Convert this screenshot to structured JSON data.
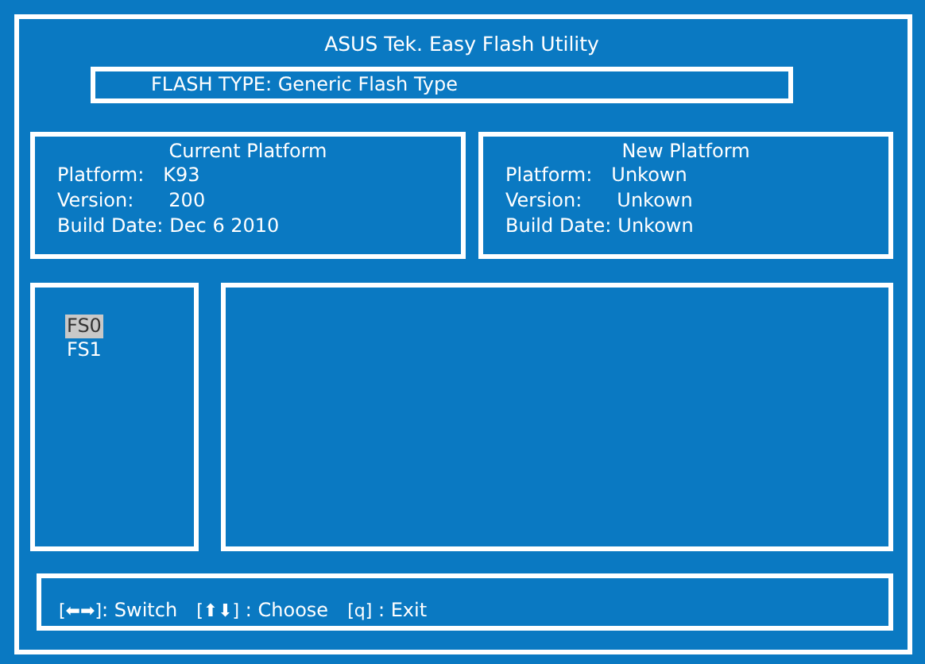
{
  "title": "ASUS Tek. Easy Flash Utility",
  "flash_type": "FLASH TYPE: Generic Flash Type",
  "platforms": [
    {
      "heading": "Current Platform",
      "rows": [
        {
          "label": "Platform:",
          "value": "K93"
        },
        {
          "label": "Version:",
          "value": "200"
        },
        {
          "label": "Build Date:",
          "value": "Dec 6 2010"
        }
      ]
    },
    {
      "heading": "New Platform",
      "rows": [
        {
          "label": "Platform:",
          "value": "Unkown"
        },
        {
          "label": "Version:",
          "value": "Unkown"
        },
        {
          "label": "Build Date:",
          "value": "Unkown"
        }
      ]
    }
  ],
  "drives": [
    {
      "label": "FS0",
      "selected": true
    },
    {
      "label": "FS1",
      "selected": false
    }
  ],
  "help": [
    {
      "keys": "[⬅➡]",
      "action": ": Switch"
    },
    {
      "keys": "[⬆⬇]",
      "action": " : Choose"
    },
    {
      "keys": "[q]",
      "action": " : Exit"
    }
  ]
}
